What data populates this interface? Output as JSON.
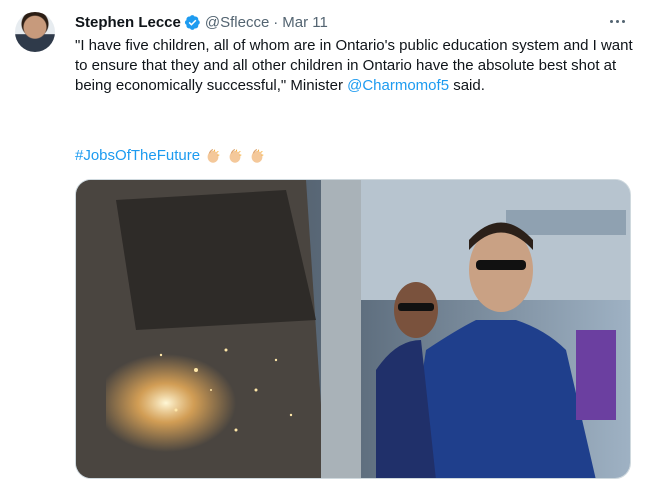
{
  "tweet": {
    "author_name": "Stephen Lecce",
    "handle": "@Sflecce",
    "separator": "·",
    "date": "Mar 11",
    "body_text": "\"I have five children, all of whom are in Ontario's public education system and I want to ensure that they and all other children in Ontario have the absolute best shot at being economically successful,\" Minister ",
    "mention": "@Charmomof5",
    "body_suffix": " said.",
    "hashtag": "#JobsOfTheFuture",
    "emoji_count": 3,
    "icons": [
      "avatar",
      "verified-badge-icon",
      "more-options-icon",
      "clapping-hands-icon"
    ],
    "colors": {
      "link": "#1d9bf0",
      "muted": "#536471",
      "text": "#0f1419",
      "verified": "#1d9bf0"
    }
  }
}
